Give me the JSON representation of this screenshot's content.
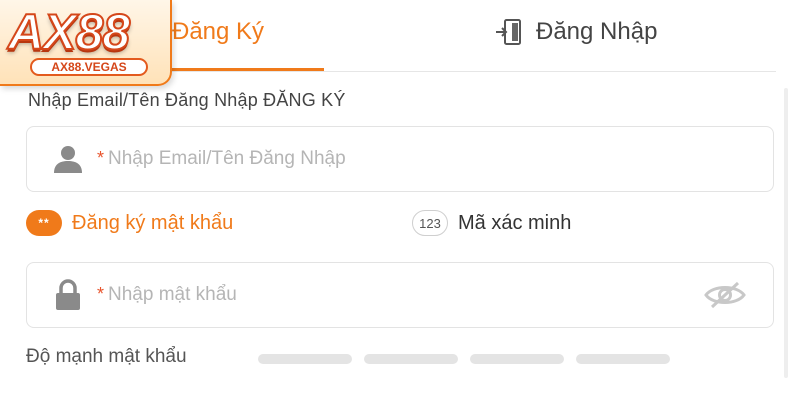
{
  "logo": {
    "main": "AX88",
    "sub": "AX88.VEGAS"
  },
  "tabs": {
    "register": "Đăng Ký",
    "login": "Đăng Nhập"
  },
  "form": {
    "email_label": "Nhập Email/Tên Đăng Nhập ĐĂNG KÝ",
    "email_required_mark": "*",
    "email_placeholder": "Nhập Email/Tên Đăng Nhập",
    "method_password": "Đăng ký mật khẩu",
    "method_password_icon_text": "**",
    "method_code": "Mã xác minh",
    "method_code_icon_text": "123",
    "password_required_mark": "*",
    "password_placeholder": "Nhập mật khẩu",
    "strength_label": "Độ mạnh mật khẩu"
  },
  "icons": {
    "logo": "brand-logo",
    "login": "door-exit-icon",
    "email": "user-icon",
    "password": "lock-icon",
    "visibility": "eye-slash-icon"
  },
  "colors": {
    "accent": "#f07a1a",
    "required": "#e8542c",
    "border": "#e3e3e3",
    "strength_empty": "#e4e4e4"
  }
}
